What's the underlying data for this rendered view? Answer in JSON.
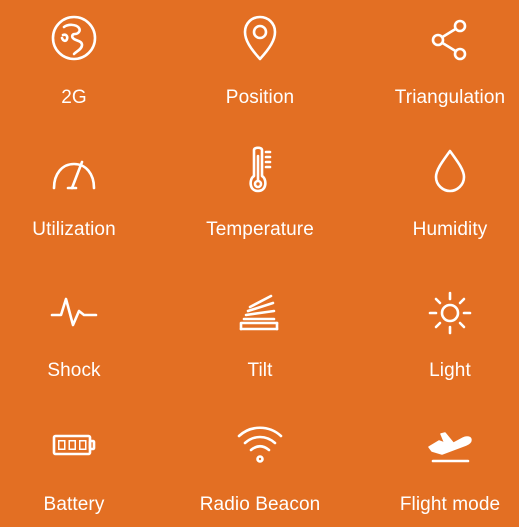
{
  "theme": {
    "background": "#e36f23",
    "foreground": "#ffffff"
  },
  "tiles": [
    {
      "label": "2G",
      "icon": "globe-icon"
    },
    {
      "label": "Position",
      "icon": "location-pin-icon"
    },
    {
      "label": "Triangulation",
      "icon": "share-nodes-icon"
    },
    {
      "label": "Utilization",
      "icon": "gauge-icon"
    },
    {
      "label": "Temperature",
      "icon": "thermometer-icon"
    },
    {
      "label": "Humidity",
      "icon": "droplet-icon"
    },
    {
      "label": "Shock",
      "icon": "pulse-icon"
    },
    {
      "label": "Tilt",
      "icon": "tilt-icon"
    },
    {
      "label": "Light",
      "icon": "sun-icon"
    },
    {
      "label": "Battery",
      "icon": "battery-icon"
    },
    {
      "label": "Radio Beacon",
      "icon": "wifi-icon"
    },
    {
      "label": "Flight mode",
      "icon": "airplane-takeoff-icon"
    }
  ]
}
